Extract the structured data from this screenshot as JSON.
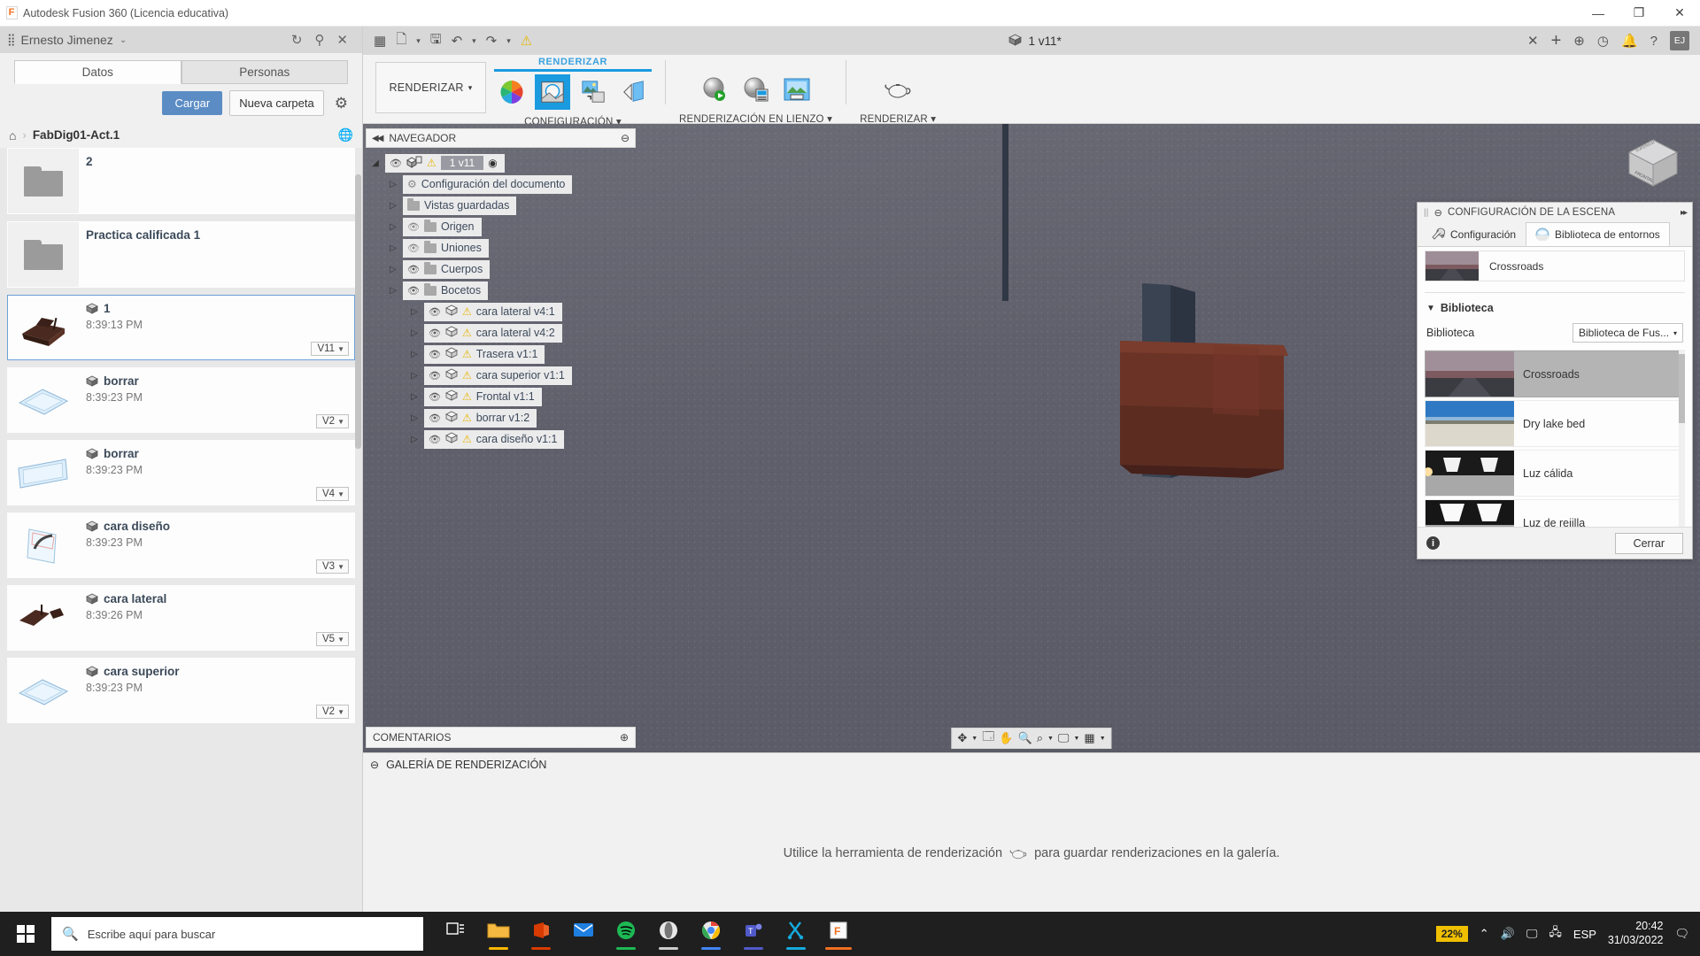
{
  "window": {
    "title": "Autodesk Fusion 360 (Licencia educativa)",
    "logo_letter": "F",
    "minimize": "—",
    "maximize": "❐",
    "close": "✕"
  },
  "data_panel": {
    "user_name": "Ernesto Jimenez",
    "user_caret": "⌄",
    "people_icon": "people-icon",
    "refresh_icon": "↻",
    "search_icon": "⚲",
    "close_icon": "✕",
    "tabs": [
      {
        "label": "Datos",
        "active": true
      },
      {
        "label": "Personas",
        "active": false
      }
    ],
    "upload_button": "Cargar",
    "new_folder_button": "Nueva carpeta",
    "settings_icon": "⚙",
    "breadcrumb": {
      "home_icon": "⌂",
      "separator": "›",
      "current": "FabDig01-Act.1",
      "globe_icon": "🌐"
    },
    "items": [
      {
        "type": "folder",
        "name": "2",
        "time": "",
        "version": ""
      },
      {
        "type": "folder",
        "name": "Practica calificada 1",
        "time": "",
        "version": ""
      },
      {
        "type": "file",
        "name": "1",
        "time": "8:39:13 PM",
        "version": "V11",
        "selected": true
      },
      {
        "type": "file",
        "name": "borrar",
        "time": "8:39:23 PM",
        "version": "V2"
      },
      {
        "type": "file",
        "name": "borrar",
        "time": "8:39:23 PM",
        "version": "V4"
      },
      {
        "type": "file",
        "name": "cara diseño",
        "time": "8:39:23 PM",
        "version": "V3"
      },
      {
        "type": "file",
        "name": "cara lateral",
        "time": "8:39:26 PM",
        "version": "V5"
      },
      {
        "type": "file",
        "name": "cara superior",
        "time": "8:39:23 PM",
        "version": "V2"
      }
    ]
  },
  "appbar": {
    "grid_icon": "▦",
    "new_icon": "🗋",
    "save_icon": "🖫",
    "undo_icon": "↶",
    "redo_icon": "↷",
    "warn_icon": "⚠",
    "doc_title": "1 v11*",
    "doc_close": "✕",
    "add_tab": "+",
    "help_icon": "?",
    "bell_icon": "🔔",
    "clock_icon": "◷",
    "globe_icon": "⊕",
    "avatar_initials": "EJ"
  },
  "ribbon": {
    "workspace_label": "RENDERIZAR",
    "workspace_caret": "▾",
    "groups": [
      {
        "title_top": "RENDERIZAR",
        "title_bottom": "CONFIGURACIÓN ▾",
        "active": true
      },
      {
        "title_top": "",
        "title_bottom": "RENDERIZACIÓN EN LIENZO ▾",
        "active": false
      },
      {
        "title_top": "",
        "title_bottom": "RENDERIZAR ▾",
        "active": false
      }
    ]
  },
  "navigator": {
    "title": "NAVEGADOR",
    "collapse_icon": "◀◀",
    "menu_icon": "⊖",
    "root": {
      "label": "1 v11",
      "eye": "◉",
      "warn": "⚠"
    },
    "nodes": [
      {
        "label": "Configuración del documento",
        "icon": "gear",
        "eye": "none",
        "warn": false,
        "indent": 1
      },
      {
        "label": "Vistas guardadas",
        "icon": "folder",
        "eye": "none",
        "warn": false,
        "indent": 1
      },
      {
        "label": "Origen",
        "icon": "folder",
        "eye": "off",
        "warn": false,
        "indent": 1
      },
      {
        "label": "Uniones",
        "icon": "folder",
        "eye": "off",
        "warn": false,
        "indent": 1
      },
      {
        "label": "Cuerpos",
        "icon": "folder",
        "eye": "on",
        "warn": false,
        "indent": 1
      },
      {
        "label": "Bocetos",
        "icon": "folder",
        "eye": "on",
        "warn": false,
        "indent": 1
      },
      {
        "label": "cara lateral v4:1",
        "icon": "cube",
        "eye": "on",
        "warn": true,
        "indent": 1
      },
      {
        "label": "cara lateral v4:2",
        "icon": "cube",
        "eye": "on",
        "warn": true,
        "indent": 1
      },
      {
        "label": "Trasera v1:1",
        "icon": "cube",
        "eye": "on",
        "warn": true,
        "indent": 1
      },
      {
        "label": "cara superior v1:1",
        "icon": "cube",
        "eye": "on",
        "warn": true,
        "indent": 1
      },
      {
        "label": "Frontal v1:1",
        "icon": "cube",
        "eye": "on",
        "warn": true,
        "indent": 1
      },
      {
        "label": "borrar v1:2",
        "icon": "cube",
        "eye": "on",
        "warn": true,
        "indent": 1
      },
      {
        "label": "cara diseño v1:1",
        "icon": "cube",
        "eye": "on",
        "warn": true,
        "indent": 1
      }
    ],
    "comments_label": "COMENTARIOS",
    "comments_add": "⊕"
  },
  "viewcube": {
    "front_label": "FRONTAL"
  },
  "nav_toolbar": {
    "orbit": "✥",
    "look_at": "🗔",
    "pan": "✋",
    "zoom": "🔍",
    "zoom_window": "⌕",
    "display": "🖵",
    "grid": "▦",
    "caret": "▾"
  },
  "scene_dialog": {
    "title": "CONFIGURACIÓN DE LA ESCENA",
    "grip": "||",
    "minimize_icon": "⊖",
    "expand_icon": "▸▸",
    "tabs": [
      {
        "label": "Configuración",
        "icon": "wrench-icon",
        "active": false
      },
      {
        "label": "Biblioteca de entornos",
        "icon": "env-dome-icon",
        "active": true
      }
    ],
    "current_environment": "Crossroads",
    "section_title": "Biblioteca",
    "section_caret": "▼",
    "library_label": "Biblioteca",
    "library_value": "Biblioteca de Fus...",
    "library_caret": "▾",
    "environments": [
      {
        "name": "Crossroads",
        "selected": true
      },
      {
        "name": "Dry lake bed",
        "selected": false
      },
      {
        "name": "Luz cálida",
        "selected": false
      },
      {
        "name": "Luz de rejilla",
        "selected": false
      }
    ],
    "info_icon": "i",
    "close_button": "Cerrar"
  },
  "gallery": {
    "title": "GALERÍA DE RENDERIZACIÓN",
    "minimize_icon": "⊖",
    "empty_message_before": "Utilice la herramienta de renderización",
    "empty_message_after": "para guardar renderizaciones en la galería."
  },
  "taskbar": {
    "search_placeholder": "Escribe aquí para buscar",
    "search_icon": "search-icon",
    "task_view_icon": "task-view-icon",
    "apps": [
      {
        "name": "file-explorer",
        "color": "#f5b942",
        "underline": "#ffb900",
        "glyph": "🗀"
      },
      {
        "name": "office",
        "color": "#d83b01",
        "underline": "#d83b01",
        "glyph": "▮"
      },
      {
        "name": "mail",
        "color": "#0a84ff",
        "underline": "#0a84ff",
        "glyph": "✉"
      },
      {
        "name": "spotify",
        "color": "#1db954",
        "underline": "#1db954",
        "glyph": "♫"
      },
      {
        "name": "opera",
        "color": "#e8e8e8",
        "underline": "#cccccc",
        "glyph": "O"
      },
      {
        "name": "chrome",
        "color": "#4285f4",
        "underline": "#4285f4",
        "glyph": "◍"
      },
      {
        "name": "teams",
        "color": "#5059c9",
        "underline": "#5059c9",
        "glyph": "T"
      },
      {
        "name": "cura",
        "color": "#16aadd",
        "underline": "#16aadd",
        "glyph": "✂"
      },
      {
        "name": "fusion360",
        "color": "#f07020",
        "underline": "#f07020",
        "glyph": "F"
      }
    ],
    "battery_percent": "22%",
    "tray_up": "⌃",
    "volume_icon": "🔊",
    "network_icon": "🖧",
    "display_icon": "🖵",
    "language": "ESP",
    "time": "20:42",
    "date": "31/03/2022",
    "notification_icon": "🗨"
  },
  "colors": {
    "accent_blue": "#1a9be0",
    "primary_button": "#5b8cc4",
    "warn_yellow": "#e8b600",
    "battery_yellow": "#f0c000"
  }
}
